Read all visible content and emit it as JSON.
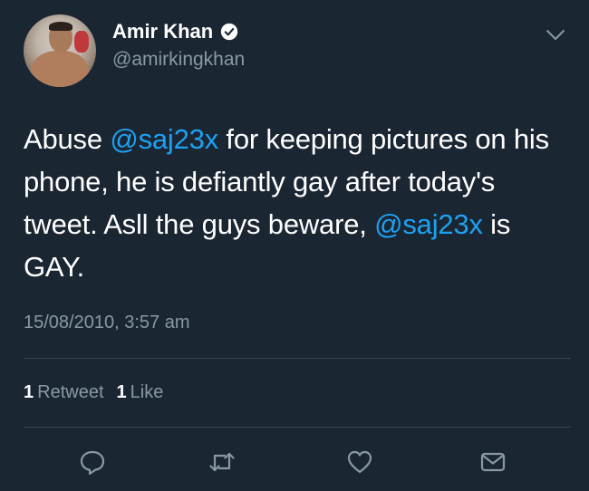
{
  "tweet": {
    "author": {
      "display_name": "Amir Khan",
      "handle": "@amirkingkhan",
      "verified": true
    },
    "text_segments": [
      {
        "text": "Abuse ",
        "type": "text"
      },
      {
        "text": "@saj23x",
        "type": "mention"
      },
      {
        "text": " for keeping pictures on his phone, he is defiantly gay after today's tweet. Asll the guys beware, ",
        "type": "text"
      },
      {
        "text": "@saj23x",
        "type": "mention"
      },
      {
        "text": " is GAY.",
        "type": "text"
      }
    ],
    "timestamp": "15/08/2010, 3:57 am",
    "stats": {
      "retweet_count": "1",
      "retweet_label": "Retweet",
      "like_count": "1",
      "like_label": "Like"
    }
  },
  "icons": {
    "verified": "verified-badge-icon",
    "menu": "chevron-down-icon",
    "reply": "reply-icon",
    "retweet": "retweet-icon",
    "like": "heart-icon",
    "share": "envelope-icon"
  },
  "colors": {
    "background": "#1b2633",
    "text": "#ffffff",
    "secondary_text": "#8899a6",
    "link": "#1da1f2",
    "divider": "#38444d"
  }
}
